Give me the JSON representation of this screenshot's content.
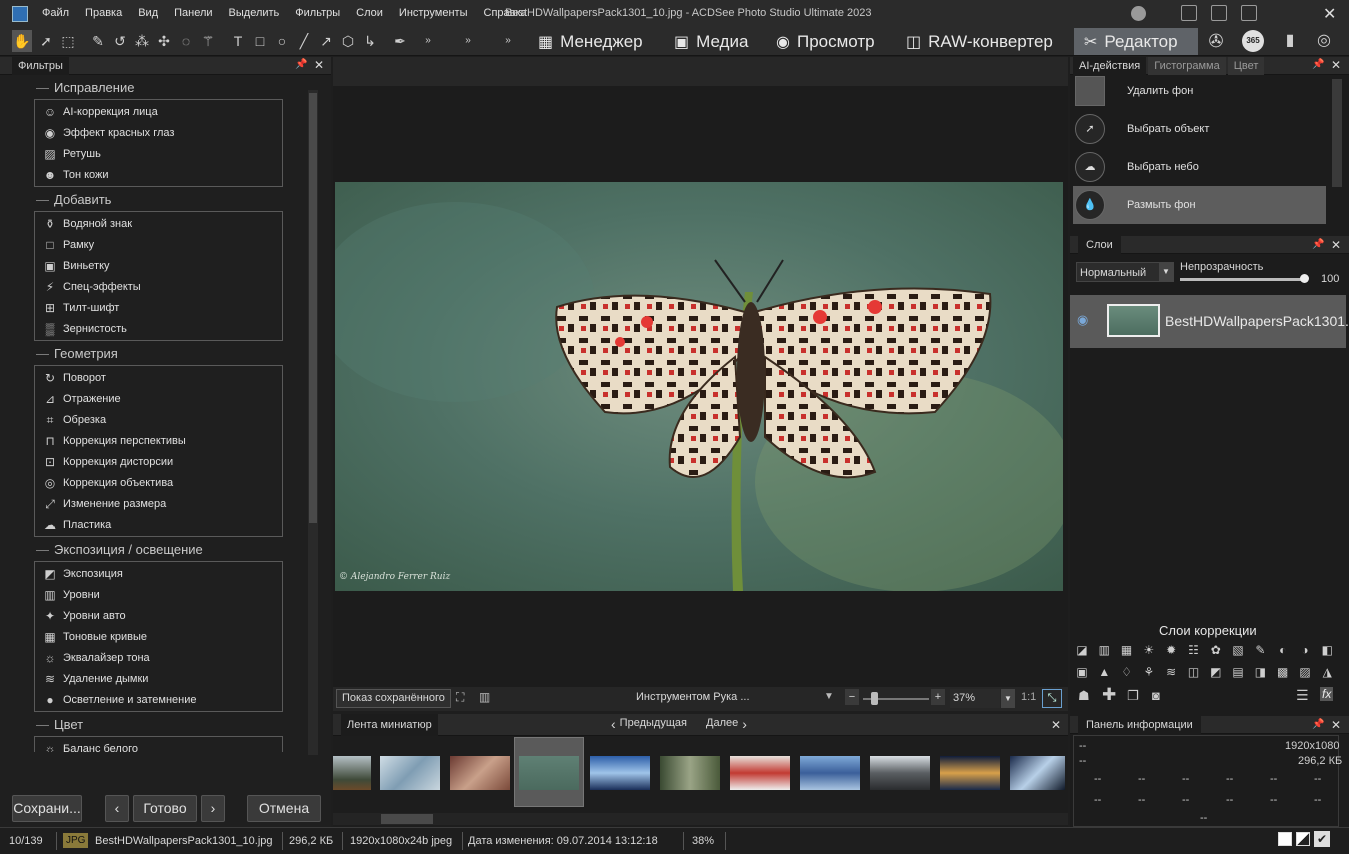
{
  "menu": [
    "Файл",
    "Правка",
    "Вид",
    "Панели",
    "Выделить",
    "Фильтры",
    "Слои",
    "Инструменты",
    "Справка"
  ],
  "window_title": "BestHDWallpapersPack1301_10.jpg - ACDSee Photo Studio Ultimate 2023",
  "modes": [
    {
      "label": "Менеджер",
      "icon": "grid-icon"
    },
    {
      "label": "Медиа",
      "icon": "media-icon"
    },
    {
      "label": "Просмотр",
      "icon": "eye-icon"
    },
    {
      "label": "RAW-конвертер",
      "icon": "raw-icon"
    },
    {
      "label": "Редактор",
      "icon": "editor-icon"
    }
  ],
  "left_panel": {
    "tab": "Фильтры",
    "groups": [
      {
        "title": "Исправление",
        "items": [
          "AI-коррекция лица",
          "Эффект красных глаз",
          "Ретушь",
          "Тон кожи"
        ]
      },
      {
        "title": "Добавить",
        "items": [
          "Водяной знак",
          "Рамку",
          "Виньетку",
          "Спец-эффекты",
          "Тилт-шифт",
          "Зернистость"
        ]
      },
      {
        "title": "Геометрия",
        "items": [
          "Поворот",
          "Отражение",
          "Обрезка",
          "Коррекция перспективы",
          "Коррекция дисторсии",
          "Коррекция объектива",
          "Изменение размера",
          "Пластика"
        ]
      },
      {
        "title": "Экспозиция / освещение",
        "items": [
          "Экспозиция",
          "Уровни",
          "Уровни авто",
          "Тоновые кривые",
          "Эквалайзер тона",
          "Удаление дымки",
          "Осветление и затемнение"
        ]
      },
      {
        "title": "Цвет",
        "items": [
          "Баланс белого"
        ]
      }
    ],
    "buttons": {
      "save": "Сохрани...",
      "prev": "‹",
      "done": "Готово",
      "next": "›",
      "cancel": "Отмена"
    }
  },
  "photo": {
    "watermark": "© Alejandro Ferrer Ruiz"
  },
  "view_bar": {
    "show_saved": "Показ сохранённого",
    "tool_text": "Инструментом Рука ...",
    "zoom": "37%",
    "ratio": "1:1"
  },
  "filmstrip": {
    "tab": "Лента миниатюр",
    "prev": "Предыдущая",
    "next": "Далее"
  },
  "right_panel": {
    "tabs": [
      "AI-действия",
      "Гистограмма",
      "Цвет"
    ],
    "ai_actions": [
      "Удалить фон",
      "Выбрать объект",
      "Выбрать небо",
      "Размыть фон"
    ],
    "layers_tab": "Слои",
    "blend_mode": "Нормальный",
    "opacity_label": "Непрозрачность",
    "opacity_value": "100",
    "layer_name": "BestHDWallpapersPack1301...",
    "correction_title": "Слои коррекции",
    "info_tab": "Панель информации",
    "info": {
      "dash": "--",
      "resolution": "1920x1080",
      "size": "296,2 КБ"
    }
  },
  "status": {
    "count": "10/139",
    "type": "JPG",
    "file": "BestHDWallpapersPack1301_10.jpg",
    "size": "296,2 КБ",
    "dims": "1920x1080x24b jpeg",
    "date": "Дата изменения: 09.07.2014 13:12:18",
    "zoom": "38%"
  },
  "colors": {
    "active_mode": "#5f6368",
    "panel": "#1f1f1f",
    "accent_red": "#e53935"
  }
}
